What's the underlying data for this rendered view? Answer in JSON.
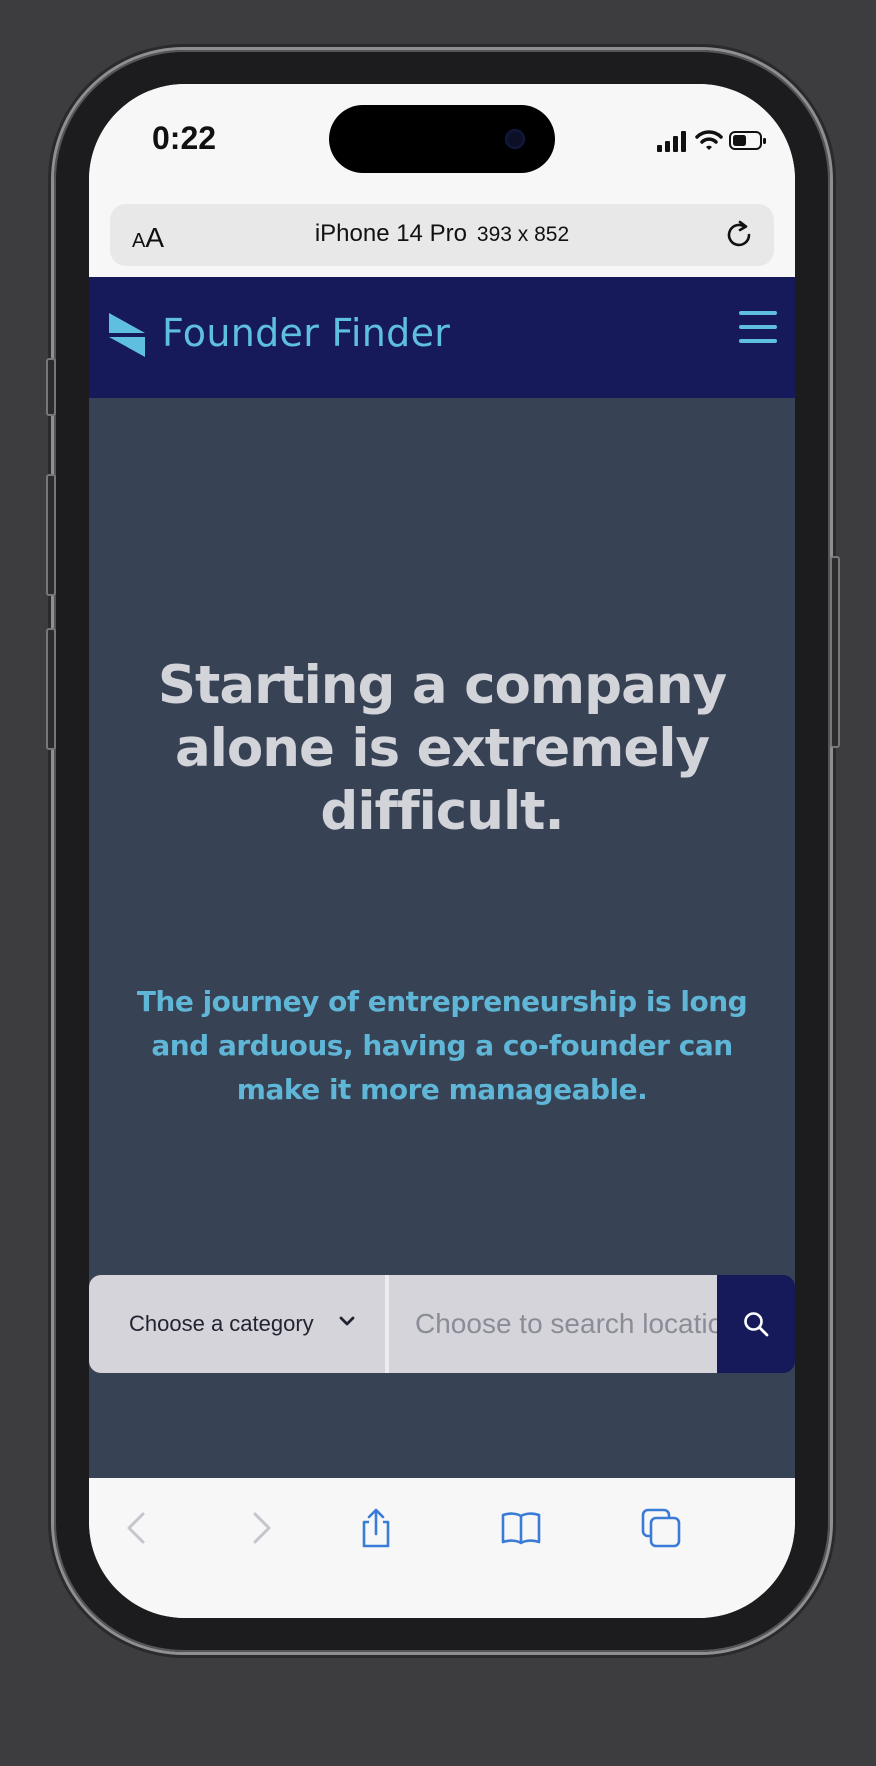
{
  "status_bar": {
    "time": "0:22",
    "icons": [
      "cellular-signal-icon",
      "wifi-icon",
      "battery-icon"
    ]
  },
  "url_bar": {
    "text_size_label_small": "A",
    "text_size_label_large": "A",
    "device_name": "iPhone 14 Pro",
    "device_dimensions": "393 x 852",
    "reload_icon": "reload-icon"
  },
  "navbar": {
    "brand": "Founder Finder",
    "logo_icon": "flag-logo-icon",
    "menu_icon": "hamburger-menu-icon",
    "background": "#161a5a",
    "accent": "#5ebfdf"
  },
  "hero": {
    "headline": "Starting a company alone is extremely difficult.",
    "subheadline": "The journey of entrepreneurship is long and arduous, having a co-founder can make it more manageable.",
    "background": "#374254"
  },
  "search": {
    "category_label": "Choose a category",
    "location_placeholder": "Choose to search location",
    "button_icon": "search-icon"
  },
  "toolbar": {
    "icons": [
      "back-icon",
      "forward-icon",
      "share-icon",
      "bookmarks-icon",
      "tabs-icon"
    ]
  }
}
